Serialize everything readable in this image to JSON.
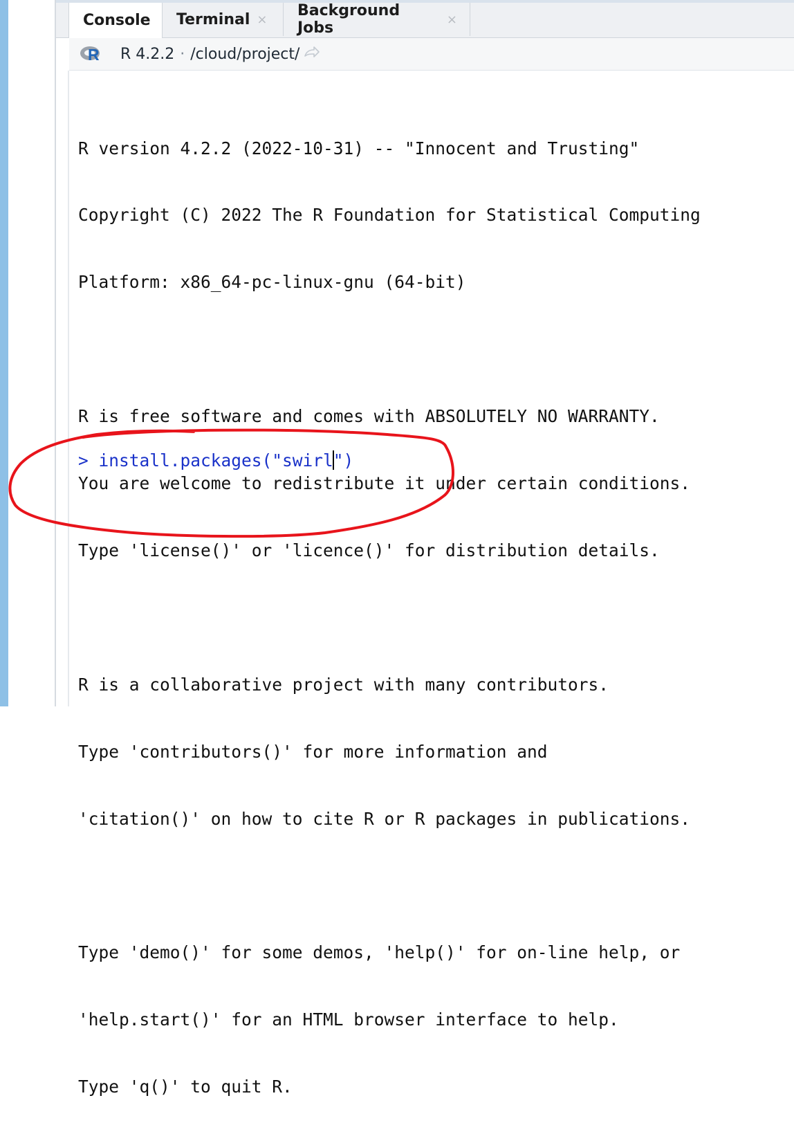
{
  "tabs": [
    {
      "label": "Console",
      "closable": false,
      "active": true
    },
    {
      "label": "Terminal",
      "closable": true,
      "active": false
    },
    {
      "label": "Background Jobs",
      "closable": true,
      "active": false
    }
  ],
  "tab_close_glyph": "×",
  "subbar": {
    "r_logo_letter": "R",
    "r_version": "R 4.2.2",
    "separator": "·",
    "path": "/cloud/project/",
    "goto_icon": "arrow-right-icon"
  },
  "console": {
    "lines": [
      "R version 4.2.2 (2022-10-31) -- \"Innocent and Trusting\"",
      "Copyright (C) 2022 The R Foundation for Statistical Computing",
      "Platform: x86_64-pc-linux-gnu (64-bit)",
      "",
      "R is free software and comes with ABSOLUTELY NO WARRANTY.",
      "You are welcome to redistribute it under certain conditions.",
      "Type 'license()' or 'licence()' for distribution details.",
      "",
      "R is a collaborative project with many contributors.",
      "Type 'contributors()' for more information and",
      "'citation()' on how to cite R or R packages in publications.",
      "",
      "Type 'demo()' for some demos, 'help()' for on-line help, or",
      "'help.start()' for an HTML browser interface to help.",
      "Type 'q()' to quit R."
    ],
    "prompt": ">",
    "input_before_cursor": "install.packages(\"swirl",
    "input_after_cursor": "\")"
  },
  "colors": {
    "input_text": "#1a32c9",
    "annotation_stroke": "#e8141b",
    "left_strip": "#8ec0e6"
  }
}
